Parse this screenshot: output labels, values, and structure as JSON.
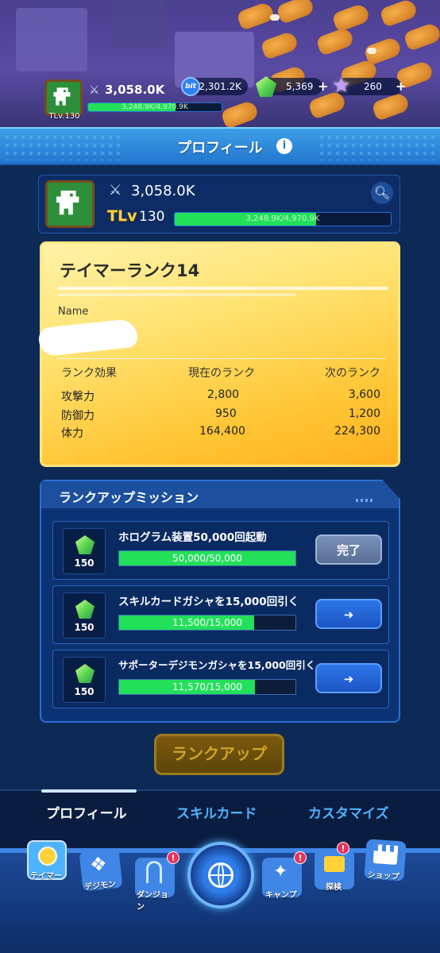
{
  "hud": {
    "tamer_level": "TLv.130",
    "power": "3,058.0K",
    "xp_text": "3,248.9K/4,970.9K",
    "xp_fraction": 0.654,
    "bit_label": "bit",
    "bit": "2,301.2K",
    "gems": "5,369",
    "stars": "260",
    "plus": "+"
  },
  "header": {
    "title": "プロフィール",
    "info_icon": "i"
  },
  "profile": {
    "power": "3,058.0K",
    "tlv_prefix": "TLv",
    "level": "130",
    "xp_text": "3,248.9K/4,970.9K",
    "xp_fraction": 0.654
  },
  "rank_card": {
    "title": "テイマーランク14",
    "name_label": "Name",
    "headers": [
      "ランク効果",
      "現在のランク",
      "次のランク"
    ],
    "rows": [
      {
        "label": "攻撃力",
        "current": "2,800",
        "next": "3,600"
      },
      {
        "label": "防御力",
        "current": "950",
        "next": "1,200"
      },
      {
        "label": "体力",
        "current": "164,400",
        "next": "224,300"
      }
    ]
  },
  "missions": {
    "title": "ランクアップミッション",
    "items": [
      {
        "reward": "150",
        "title": "ホログラム装置50,000回起動",
        "progress_text": "50,000/50,000",
        "fraction": 1.0,
        "button": "完了",
        "button_type": "done"
      },
      {
        "reward": "150",
        "title": "スキルカードガシャを15,000回引く",
        "progress_text": "11,500/15,000",
        "fraction": 0.767,
        "button": "➜",
        "button_type": "go"
      },
      {
        "reward": "150",
        "title": "サポーターデジモンガシャを15,000回引く",
        "progress_text": "11,570/15,000",
        "fraction": 0.771,
        "button": "➜",
        "button_type": "go"
      }
    ]
  },
  "rank_up_button": "ランクアップ",
  "tabs": [
    "プロフィール",
    "スキルカード",
    "カスタマイズ"
  ],
  "nav": [
    {
      "label": "テイマー",
      "icon": "tamer-icon"
    },
    {
      "label": "デジモン",
      "icon": "digimon-icon"
    },
    {
      "label": "ダンジョン",
      "icon": "dungeon-icon",
      "badge": "!"
    },
    {
      "label": "",
      "icon": "globe-icon"
    },
    {
      "label": "キャンプ",
      "icon": "camp-icon",
      "badge": "!"
    },
    {
      "label": "探検",
      "icon": "explore-icon",
      "badge": "!"
    },
    {
      "label": "ショップ",
      "icon": "shop-icon"
    }
  ],
  "colors": {
    "accent": "#2277cf",
    "xp": "#22e05a",
    "gold": "#ffc534",
    "alert": "#e8335a"
  }
}
